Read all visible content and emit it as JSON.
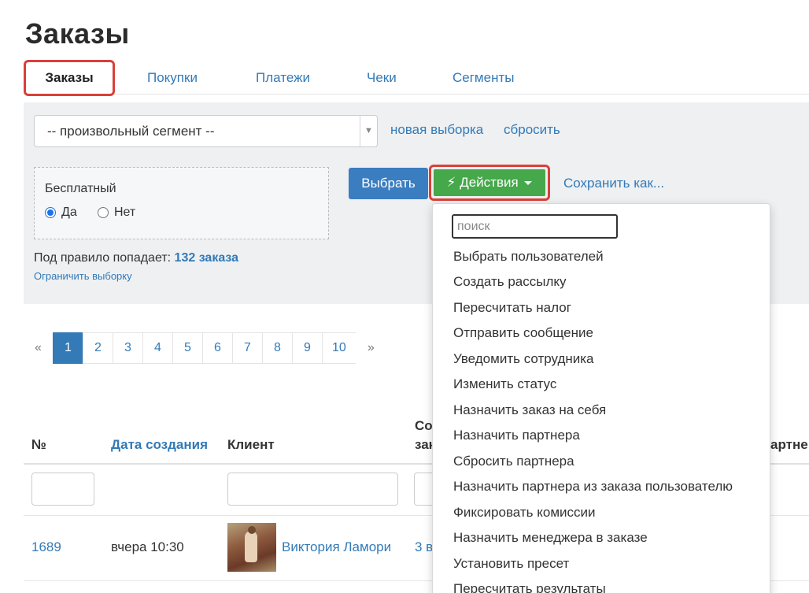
{
  "page": {
    "title": "Заказы"
  },
  "tabs": [
    "Заказы",
    "Покупки",
    "Платежи",
    "Чеки",
    "Сегменты"
  ],
  "filter": {
    "segment_value": "-- произвольный сегмент --",
    "new_selection_link": "новая выборка",
    "reset_link": "сбросить",
    "condition": {
      "title": "Бесплатный",
      "options": [
        "Да",
        "Нет"
      ],
      "selected": "Да"
    },
    "choose_button": "Выбрать",
    "actions_button": "Действия",
    "save_as_link": "Сохранить как...",
    "rule_prefix": "Под правило попадает:",
    "rule_count": "132 заказа",
    "limit_link": "Ограничить выборку"
  },
  "pagination": {
    "prev": "«",
    "pages": [
      "1",
      "2",
      "3",
      "4",
      "5",
      "6",
      "7",
      "8",
      "9",
      "10"
    ],
    "next": "»",
    "current": "1"
  },
  "table": {
    "headers": {
      "number": "№",
      "created": "Дата создания",
      "client": "Клиент",
      "composition_line1": "Со",
      "composition_line2": "зак",
      "partner": "артне"
    },
    "rows": [
      {
        "number": "1689",
        "created": "вчера 10:30",
        "client": "Виктория Ламори",
        "composition": "3 в"
      }
    ]
  },
  "actions_menu": {
    "search_placeholder": "поиск",
    "items": [
      "Выбрать пользователей",
      "Создать рассылку",
      "Пересчитать налог",
      "Отправить сообщение",
      "Уведомить сотрудника",
      "Изменить статус",
      "Назначить заказ на себя",
      "Назначить партнера",
      "Сбросить партнера",
      "Назначить партнера из заказа пользователю",
      "Фиксировать комиссии",
      "Назначить менеджера в заказе",
      "Установить пресет",
      "Пересчитать результаты"
    ]
  },
  "colors": {
    "link": "#337ab7",
    "primary_button": "#3a7dc1",
    "actions_button": "#45a84a",
    "highlight": "#d9403a",
    "panel_bg": "#eef0f2"
  }
}
